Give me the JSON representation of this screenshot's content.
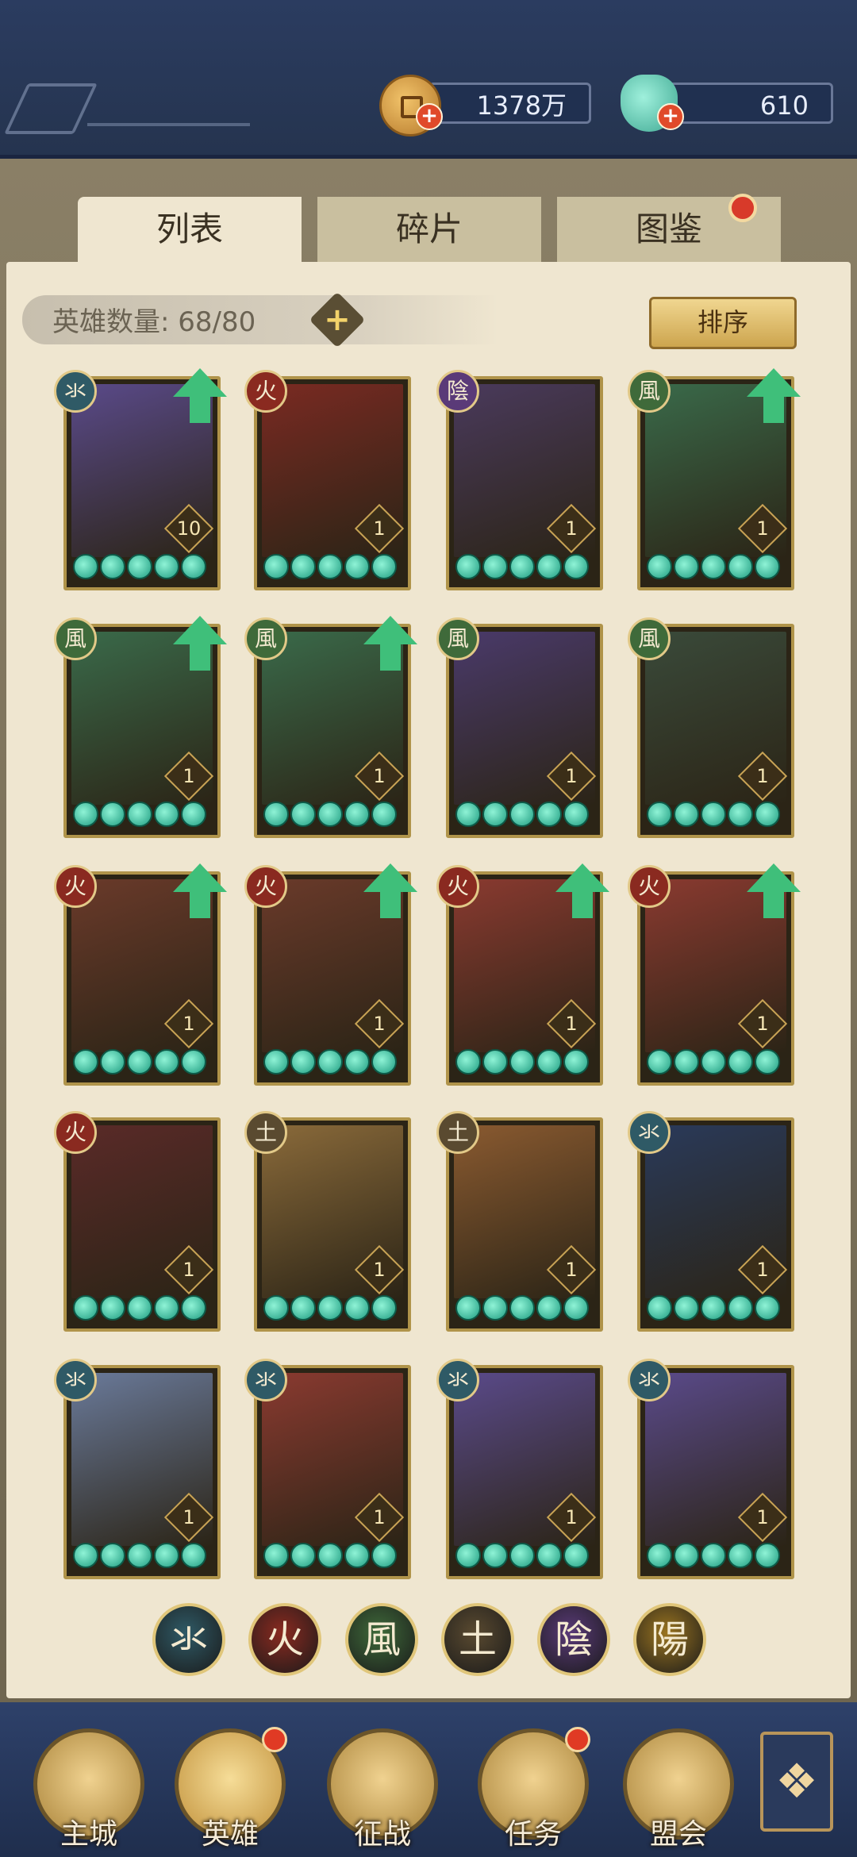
{
  "resources": {
    "copper": {
      "value": "1378万",
      "icon": "copper-coin-icon"
    },
    "shell": {
      "value": "610",
      "icon": "jade-shell-icon"
    }
  },
  "tabs": [
    {
      "label": "列表",
      "active": true
    },
    {
      "label": "碎片",
      "active": false
    },
    {
      "label": "图鉴",
      "active": false,
      "badge": true
    }
  ],
  "hero_count_label": "英雄数量: 68/80",
  "sort_label": "排序",
  "elements": {
    "water": {
      "glyph": "氺",
      "color": "#2f5a66"
    },
    "fire": {
      "glyph": "火",
      "color": "#8a2a20"
    },
    "wind": {
      "glyph": "風",
      "color": "#3f6a3a"
    },
    "earth": {
      "glyph": "土",
      "color": "#5a4a30"
    },
    "yin": {
      "glyph": "陰",
      "color": "#5a3a78"
    },
    "yang": {
      "glyph": "陽",
      "color": "#9a7420"
    }
  },
  "heroes": [
    {
      "element": "water",
      "level": "10",
      "upgrade": true,
      "stars": 5,
      "color": "#5a4a8a"
    },
    {
      "element": "fire",
      "level": "1",
      "upgrade": false,
      "stars": 5,
      "color": "#7a2a22"
    },
    {
      "element": "yin",
      "level": "1",
      "upgrade": false,
      "stars": 5,
      "color": "#4a3a5c"
    },
    {
      "element": "wind",
      "level": "1",
      "upgrade": true,
      "stars": 5,
      "color": "#3a6a4a"
    },
    {
      "element": "wind",
      "level": "1",
      "upgrade": true,
      "stars": 5,
      "color": "#3a6a4a"
    },
    {
      "element": "wind",
      "level": "1",
      "upgrade": true,
      "stars": 5,
      "color": "#3a6a4a"
    },
    {
      "element": "wind",
      "level": "1",
      "upgrade": false,
      "stars": 5,
      "color": "#4a3a6a"
    },
    {
      "element": "wind",
      "level": "1",
      "upgrade": false,
      "stars": 5,
      "color": "#3a4a3a"
    },
    {
      "element": "fire",
      "level": "1",
      "upgrade": true,
      "stars": 5,
      "color": "#6a3a2a"
    },
    {
      "element": "fire",
      "level": "1",
      "upgrade": true,
      "stars": 5,
      "color": "#6a3a2a"
    },
    {
      "element": "fire",
      "level": "1",
      "upgrade": true,
      "stars": 5,
      "color": "#8a3a30"
    },
    {
      "element": "fire",
      "level": "1",
      "upgrade": true,
      "stars": 5,
      "color": "#8a3a30"
    },
    {
      "element": "fire",
      "level": "1",
      "upgrade": false,
      "stars": 5,
      "color": "#5a2a28"
    },
    {
      "element": "earth",
      "level": "1",
      "upgrade": false,
      "stars": 5,
      "color": "#8a6a3a"
    },
    {
      "element": "earth",
      "level": "1",
      "upgrade": false,
      "stars": 5,
      "color": "#8a5a30"
    },
    {
      "element": "water",
      "level": "1",
      "upgrade": false,
      "stars": 5,
      "color": "#2a3a5a"
    },
    {
      "element": "water",
      "level": "1",
      "upgrade": false,
      "stars": 5,
      "color": "#6a7a9a"
    },
    {
      "element": "water",
      "level": "1",
      "upgrade": false,
      "stars": 5,
      "color": "#8a3a30"
    },
    {
      "element": "water",
      "level": "1",
      "upgrade": false,
      "stars": 5,
      "color": "#5a4a8a"
    },
    {
      "element": "water",
      "level": "1",
      "upgrade": false,
      "stars": 5,
      "color": "#5a4a8a"
    }
  ],
  "filters": [
    "water",
    "fire",
    "wind",
    "earth",
    "yin",
    "yang"
  ],
  "nav": [
    {
      "label": "主城",
      "icon": "city-gate-icon",
      "badge": false
    },
    {
      "label": "英雄",
      "icon": "hero-portrait-icon",
      "badge": true,
      "active": true
    },
    {
      "label": "征战",
      "icon": "battle-helmet-icon",
      "badge": false
    },
    {
      "label": "任务",
      "icon": "scroll-task-icon",
      "badge": true
    },
    {
      "label": "盟会",
      "icon": "alliance-pavilion-icon",
      "badge": false
    }
  ],
  "menu_icon": "menu-grid-icon"
}
